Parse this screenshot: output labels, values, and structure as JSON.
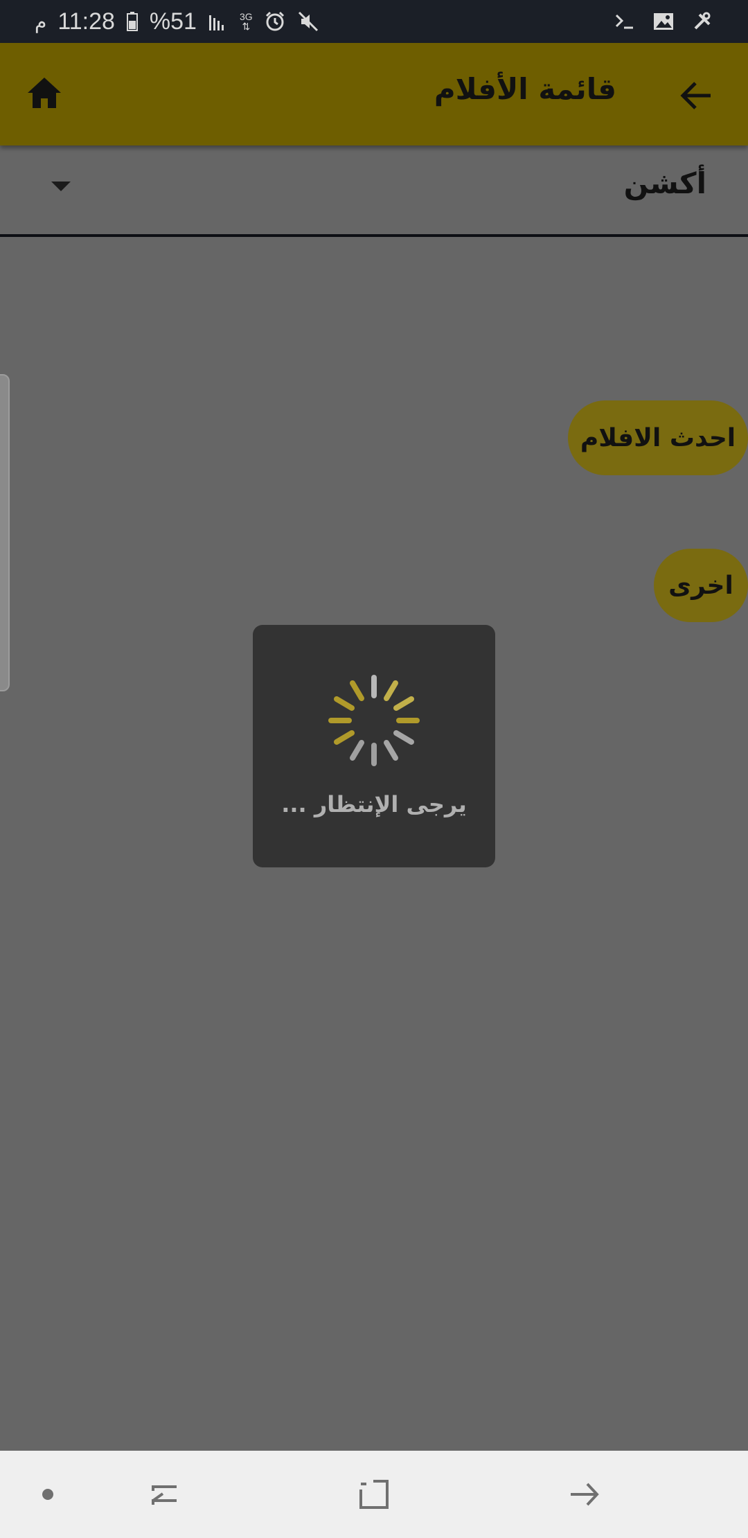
{
  "status_bar": {
    "time": "11:28",
    "period": "م",
    "battery": "%51",
    "network": "3G",
    "icons": [
      "battery-icon",
      "signal-icon",
      "network-3g-icon",
      "alarm-icon",
      "mute-icon",
      "terminal-icon",
      "image-icon",
      "tools-icon"
    ]
  },
  "app_bar": {
    "title": "قائمة الأفلام",
    "home_icon": "home-icon",
    "back_icon": "arrow-back-icon",
    "background": "#6e5e00"
  },
  "dropdown": {
    "selected": "أكشن",
    "caret_icon": "caret-down-icon"
  },
  "pills": {
    "latest": "احدث الافلام",
    "other": "اخرى",
    "color": "#7a6b10"
  },
  "loading": {
    "text": "يرجى الإنتظار ...",
    "spinner_color": "#b09a2a"
  },
  "nav_bar": {
    "buttons": [
      "dot-icon",
      "recent-apps-icon",
      "home-square-icon",
      "back-icon"
    ]
  }
}
